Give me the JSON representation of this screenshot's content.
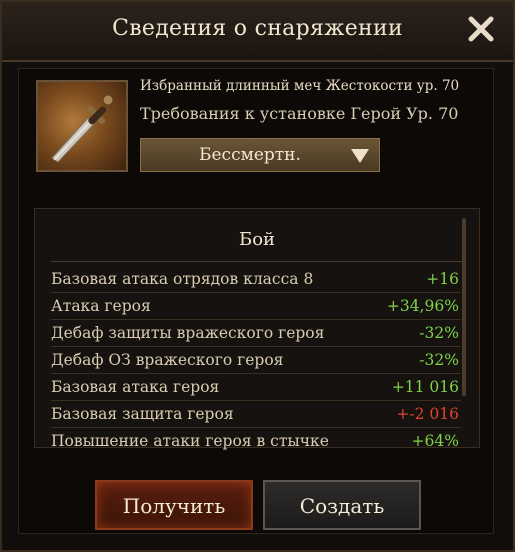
{
  "window": {
    "title": "Сведения о снаряжении",
    "close_icon": "close-icon"
  },
  "item": {
    "name": "Избранный длинный меч Жестокости ур. 70",
    "requirement": "Требования к установке Герой Ур. 70",
    "rarity": "Бессмертн.",
    "icon": "sword-icon"
  },
  "stats": {
    "header": "Бой",
    "rows": [
      {
        "label": "Базовая атака отрядов класса 8",
        "value": "+16",
        "color": "green"
      },
      {
        "label": "Атака героя",
        "value": "+34,96%",
        "color": "green"
      },
      {
        "label": "Дебаф защиты вражеского героя",
        "value": "-32%",
        "color": "green"
      },
      {
        "label": "Дебаф ОЗ вражеского героя",
        "value": "-32%",
        "color": "green"
      },
      {
        "label": "Базовая атака героя",
        "value": "+11 016",
        "color": "green"
      },
      {
        "label": "Базовая защита героя",
        "value": "+-2 016",
        "color": "red"
      },
      {
        "label": "Повышение атаки героя в стычке",
        "value": "+64%",
        "color": "green"
      }
    ]
  },
  "buttons": {
    "get_label": "Получить",
    "create_label": "Создать"
  },
  "colors": {
    "positive": "#7fd24a",
    "negative": "#e2422f",
    "accent": "#8a3a1a"
  }
}
